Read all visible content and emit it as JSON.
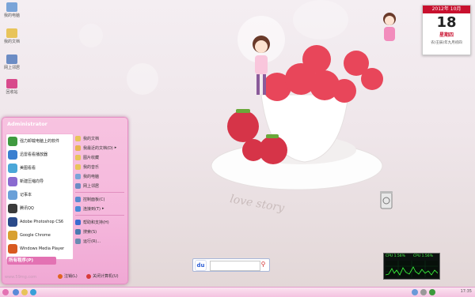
{
  "desktop": {
    "icons": [
      {
        "name": "my-computer-icon",
        "label": "我的电脑",
        "color": "#7aa4d8"
      },
      {
        "name": "my-documents-icon",
        "label": "我的文档",
        "color": "#e8c45a"
      },
      {
        "name": "network-icon",
        "label": "网上邻居",
        "color": "#6c8cc4"
      },
      {
        "name": "recycle-icon",
        "label": "回收站",
        "color": "#d84a8c"
      }
    ],
    "watermark": "www.59mg.com",
    "wallpaper_text": "love story"
  },
  "calendar": {
    "header": "2012年 10月",
    "day": "18",
    "weekday": "星期四",
    "lunar": "农(壬辰)年九月初四"
  },
  "start_menu": {
    "user": "Administrator",
    "left_items": [
      {
        "label": "强力卸载电脑上的软件",
        "icon": "uninstall-icon",
        "color": "#3f9a3f"
      },
      {
        "label": "迅雷看看播放器",
        "icon": "player-icon",
        "color": "#3a7fd0"
      },
      {
        "label": "美图看看",
        "icon": "photo-viewer-icon",
        "color": "#4aa7d8"
      },
      {
        "label": "新建压缩向导",
        "icon": "archive-icon",
        "color": "#8a6ad0"
      },
      {
        "label": "记事本",
        "icon": "notepad-icon",
        "color": "#6aa0d8"
      },
      {
        "label": "腾讯QQ",
        "icon": "qq-icon",
        "color": "#3a3a3a"
      },
      {
        "label": "Adobe Photoshop CS6",
        "icon": "photoshop-icon",
        "color": "#2a4a8a"
      },
      {
        "label": "Google Chrome",
        "icon": "chrome-icon",
        "color": "#d8a030"
      },
      {
        "label": "Windows Media Player",
        "icon": "media-player-icon",
        "color": "#d85a20"
      }
    ],
    "right_items": [
      {
        "label": "我的文档",
        "icon": "folder-icon",
        "color": "#e8c45a"
      },
      {
        "label": "我最近的文档(D)",
        "icon": "recent-docs-icon",
        "color": "#e8b450",
        "arrow": "▸"
      },
      {
        "label": "图片收藏",
        "icon": "pictures-icon",
        "color": "#e8c45a"
      },
      {
        "label": "我的音乐",
        "icon": "music-icon",
        "color": "#e8c45a"
      },
      {
        "label": "我的电脑",
        "icon": "computer-icon",
        "color": "#7aa4d8"
      },
      {
        "label": "网上邻居",
        "icon": "network-icon",
        "color": "#6c8cc4"
      },
      {
        "label": "控制面板(C)",
        "icon": "control-panel-icon",
        "color": "#5a8ad0"
      },
      {
        "label": "连接到(T)",
        "icon": "connect-icon",
        "color": "#4a8ad8",
        "arrow": "▸"
      },
      {
        "label": "帮助和支持(H)",
        "icon": "help-icon",
        "color": "#3a6ad0"
      },
      {
        "label": "搜索(S)",
        "icon": "search-icon",
        "color": "#4a7ab0"
      },
      {
        "label": "运行(R)...",
        "icon": "run-icon",
        "color": "#6a8ab0"
      }
    ],
    "all_programs": "所有程序(P)",
    "logoff": "注销(L)",
    "shutdown": "关闭计算机(U)"
  },
  "search": {
    "logo": "du",
    "placeholder": "",
    "button_icon": "search-icon"
  },
  "cpu_meter": {
    "left": "CPU 1.56%",
    "right": "CPU 1.56%"
  },
  "taskbar": {
    "time": "17:35"
  },
  "colors": {
    "accent": "#e372b3",
    "calendar_red": "#c8102e"
  }
}
